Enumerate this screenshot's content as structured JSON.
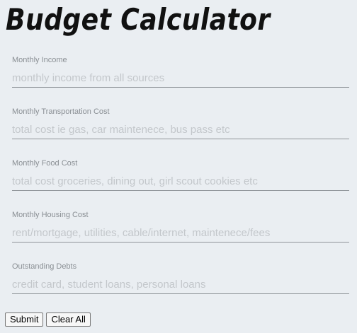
{
  "header": {
    "title": "Budget Calculator"
  },
  "form": {
    "fields": [
      {
        "label": "Monthly Income",
        "value": "",
        "placeholder": "monthly income from all sources"
      },
      {
        "label": "Monthly Transportation Cost",
        "value": "",
        "placeholder": "total cost ie gas, car maintenece, bus pass etc"
      },
      {
        "label": "Monthly Food Cost",
        "value": "",
        "placeholder": "total cost groceries, dining out, girl scout cookies etc"
      },
      {
        "label": "Monthly Housing Cost",
        "value": "",
        "placeholder": "rent/mortgage, utilities, cable/internet, maintenece/fees"
      },
      {
        "label": "Outstanding Debts",
        "value": "",
        "placeholder": "credit card, student loans, personal loans"
      }
    ]
  },
  "actions": {
    "submit_label": "Submit",
    "clear_label": "Clear All"
  },
  "colors": {
    "background": "#eaeef2",
    "title": "#111111",
    "label": "#8a8f94",
    "placeholder": "#c3c7cb",
    "underline": "#8e9398"
  }
}
